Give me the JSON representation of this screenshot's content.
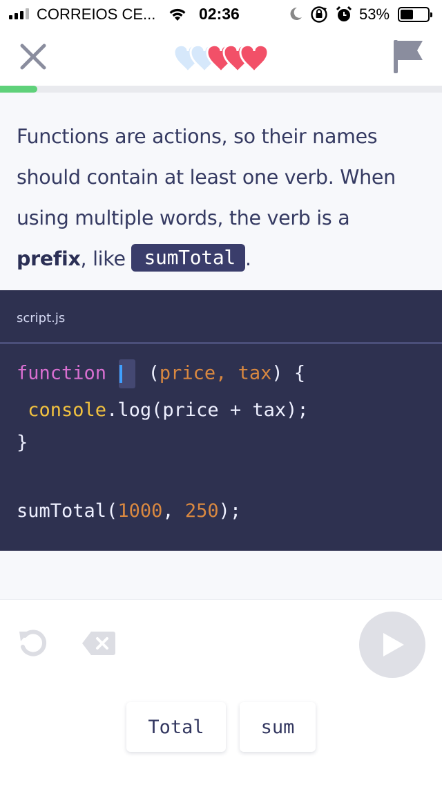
{
  "status_bar": {
    "carrier": "CORREIOS CE...",
    "time": "02:36",
    "battery_percent": "53%",
    "battery_level": 0.53,
    "icons": [
      "signal-icon",
      "wifi-icon",
      "moon-icon",
      "rotation-lock-icon",
      "alarm-icon",
      "battery-icon"
    ]
  },
  "nav": {
    "close_icon": "close-icon",
    "flag_icon": "flag-icon",
    "hearts_total": 5,
    "hearts_filled": 3,
    "colors": {
      "heart_filled": "#f25068",
      "heart_empty": "#d6e8fb"
    }
  },
  "progress": {
    "value": 0.085,
    "color": "#5fd17a"
  },
  "instruction": {
    "part1": "Functions are actions, so their names should contain at least one verb. When using multiple words, the verb is a ",
    "bold": "prefix",
    "part2": ", like ",
    "code": "sumTotal",
    "part3": "."
  },
  "editor": {
    "file_name": "script.js",
    "line1": {
      "keyword": "function",
      "space": " ",
      "open": " (",
      "param1": "price",
      "comma": ", ",
      "param2": "tax",
      "close": ") {"
    },
    "line2": {
      "indent": " ",
      "obj": "console",
      "rest": ".log(price + tax);"
    },
    "line3": "}",
    "line5": {
      "call": "sumTotal(",
      "arg1": "1000",
      "comma": ", ",
      "arg2": "250",
      "end": ");"
    },
    "colors": {
      "background": "#2e3150",
      "keyword": "#d96fd1",
      "param": "#d98840",
      "object": "#f2c23f"
    }
  },
  "controls": {
    "undo_icon": "undo-icon",
    "delete_icon": "backspace-icon",
    "run_icon": "play-icon",
    "chips": [
      "Total",
      "sum"
    ]
  }
}
